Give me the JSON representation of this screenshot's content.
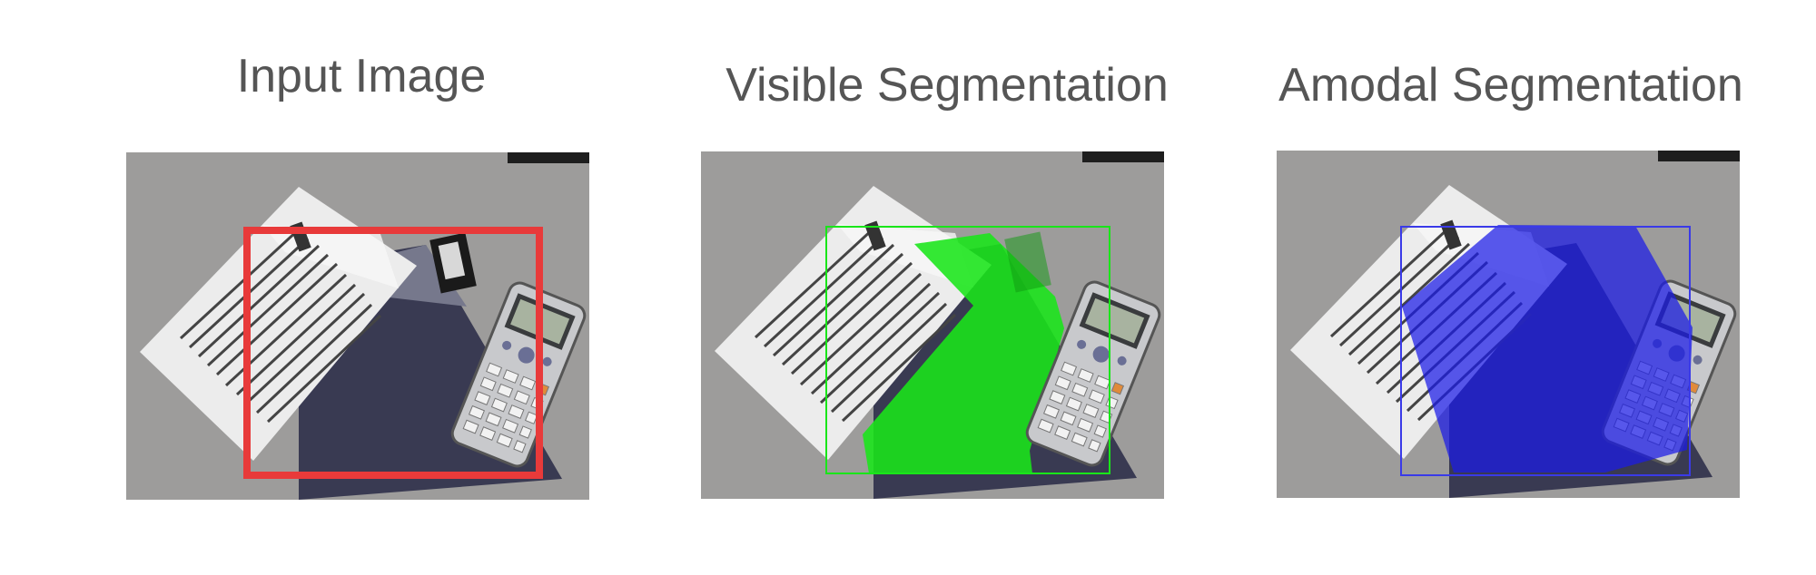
{
  "panels": [
    {
      "title": "Input Image",
      "annotation": "bounding-box",
      "color": "#e83a3a"
    },
    {
      "title": "Visible Segmentation",
      "annotation": "visible-mask",
      "color": "#19e619"
    },
    {
      "title": "Amodal Segmentation",
      "annotation": "amodal-mask",
      "color": "#1a1ae8"
    }
  ],
  "colors": {
    "title_text": "#555555",
    "background": "#ffffff",
    "desk": "#9c9b9a"
  },
  "icons": [
    "paper-sheet",
    "booklet",
    "calculator",
    "barcode-sticker"
  ]
}
